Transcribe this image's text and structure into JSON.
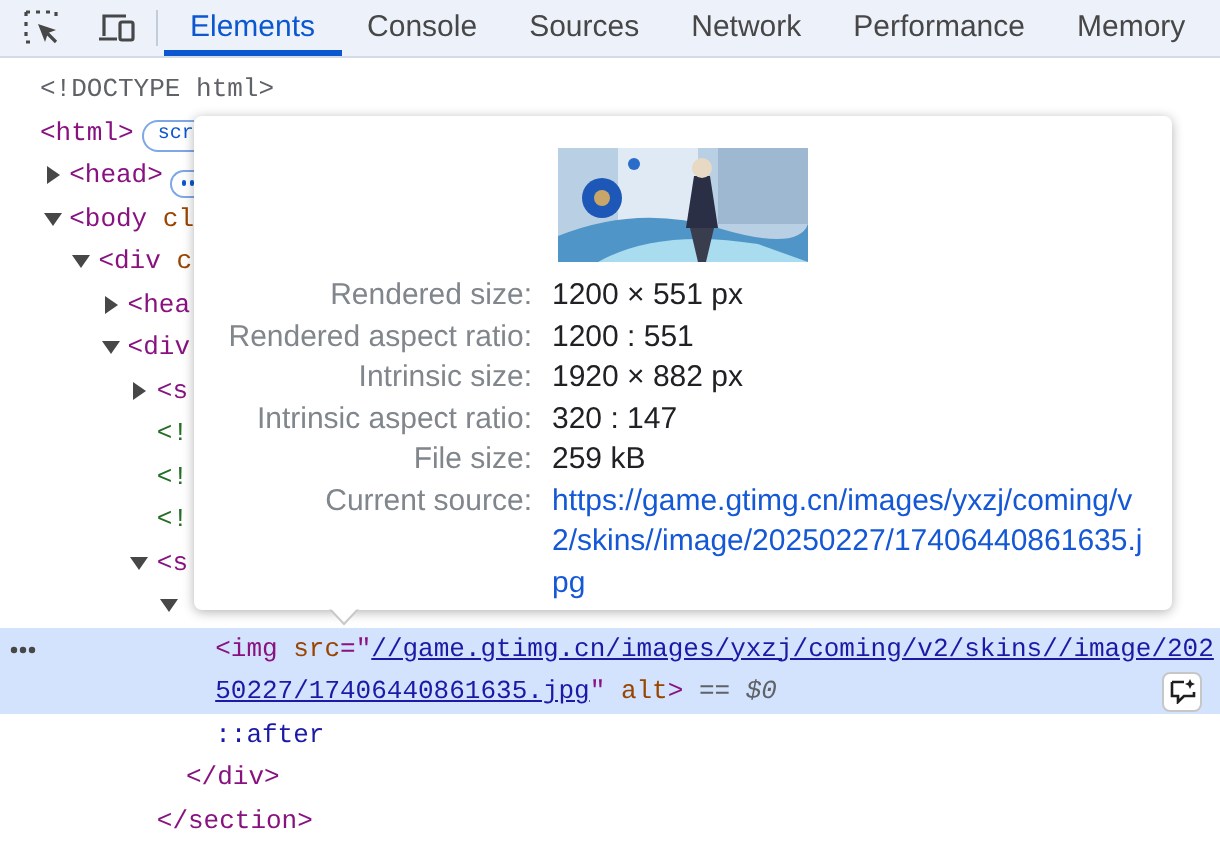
{
  "toolbar": {
    "tabs": [
      {
        "label": "Elements",
        "selected": true
      },
      {
        "label": "Console",
        "selected": false
      },
      {
        "label": "Sources",
        "selected": false
      },
      {
        "label": "Network",
        "selected": false
      },
      {
        "label": "Performance",
        "selected": false
      },
      {
        "label": "Memory",
        "selected": false
      }
    ]
  },
  "dom_tree": [
    {
      "parts": [
        {
          "kind": "doctype",
          "text": "<!DOCTYPE html>"
        }
      ],
      "selected": false
    },
    {
      "parts": [
        {
          "kind": "tag",
          "text": "<html>"
        }
      ],
      "badge": {
        "kind": "text",
        "text": "scr"
      },
      "selected": false,
      "children": [
        {
          "parts": [
            {
              "kind": "tag",
              "text": "<head>"
            }
          ],
          "badge": {
            "kind": "dots"
          },
          "expanded": false,
          "selected": false
        },
        {
          "parts": [
            {
              "kind": "tag",
              "text": "<body"
            },
            {
              "kind": "attr",
              "text": " cl"
            }
          ],
          "expanded": true,
          "selected": false,
          "children": [
            {
              "parts": [
                {
                  "kind": "tag",
                  "text": "<div"
                },
                {
                  "kind": "attr",
                  "text": " c"
                }
              ],
              "expanded": true,
              "selected": false,
              "children": [
                {
                  "parts": [
                    {
                      "kind": "tag",
                      "text": "<hea"
                    }
                  ],
                  "expanded": false,
                  "selected": false
                },
                {
                  "parts": [
                    {
                      "kind": "tag",
                      "text": "<div"
                    }
                  ],
                  "expanded": true,
                  "selected": false,
                  "children": [
                    {
                      "parts": [
                        {
                          "kind": "tag",
                          "text": "<s"
                        }
                      ],
                      "expanded": false,
                      "selected": false
                    },
                    {
                      "parts": [
                        {
                          "kind": "comment",
                          "text": "<!"
                        }
                      ],
                      "selected": false
                    },
                    {
                      "parts": [
                        {
                          "kind": "comment",
                          "text": "<!"
                        }
                      ],
                      "selected": false
                    },
                    {
                      "parts": [
                        {
                          "kind": "comment",
                          "text": "<!"
                        }
                      ],
                      "selected": false
                    },
                    {
                      "parts": [
                        {
                          "kind": "tag",
                          "text": "<s"
                        }
                      ],
                      "expanded": true,
                      "selected": false,
                      "close": [
                        {
                          "kind": "tag",
                          "text": "</section>"
                        }
                      ],
                      "children": [
                        {
                          "expanded": true,
                          "selected": false,
                          "close": [
                            {
                              "kind": "tag",
                              "text": "</div>"
                            }
                          ],
                          "children": [
                            {
                              "parts": [
                                {
                                  "kind": "tag",
                                  "text": "<img"
                                },
                                {
                                  "kind": "attr",
                                  "text": " src"
                                },
                                {
                                  "kind": "tag",
                                  "text": "=\""
                                },
                                {
                                  "kind": "link",
                                  "text": "//game.gtimg.cn/images/yxzj/coming/v2/skins//image/20250227/17406440861635.jpg"
                                },
                                {
                                  "kind": "tag",
                                  "text": "\""
                                },
                                {
                                  "kind": "attr",
                                  "text": " alt"
                                },
                                {
                                  "kind": "tag",
                                  "text": ">"
                                },
                                {
                                  "kind": "marker",
                                  "text": " == $0"
                                }
                              ],
                              "selected": true
                            },
                            {
                              "parts": [
                                {
                                  "kind": "pseudo",
                                  "text": "::after"
                                }
                              ],
                              "selected": false
                            }
                          ]
                        }
                      ]
                    }
                  ]
                }
              ]
            }
          ]
        }
      ]
    }
  ],
  "tooltip": {
    "properties": [
      {
        "label": "Rendered size:",
        "value": "1200 × 551 px",
        "kind": "text"
      },
      {
        "label": "Rendered aspect ratio:",
        "value": "1200 : 551",
        "kind": "text"
      },
      {
        "label": "Intrinsic size:",
        "value": "1920 × 882 px",
        "kind": "text"
      },
      {
        "label": "Intrinsic aspect ratio:",
        "value": "320 : 147",
        "kind": "text"
      },
      {
        "label": "File size:",
        "value": "259 kB",
        "kind": "text"
      },
      {
        "label": "Current source:",
        "value": "https://game.gtimg.cn/images/yxzj/coming/v2/skins//image/20250227/17406440861635.jpg",
        "kind": "link"
      }
    ]
  }
}
